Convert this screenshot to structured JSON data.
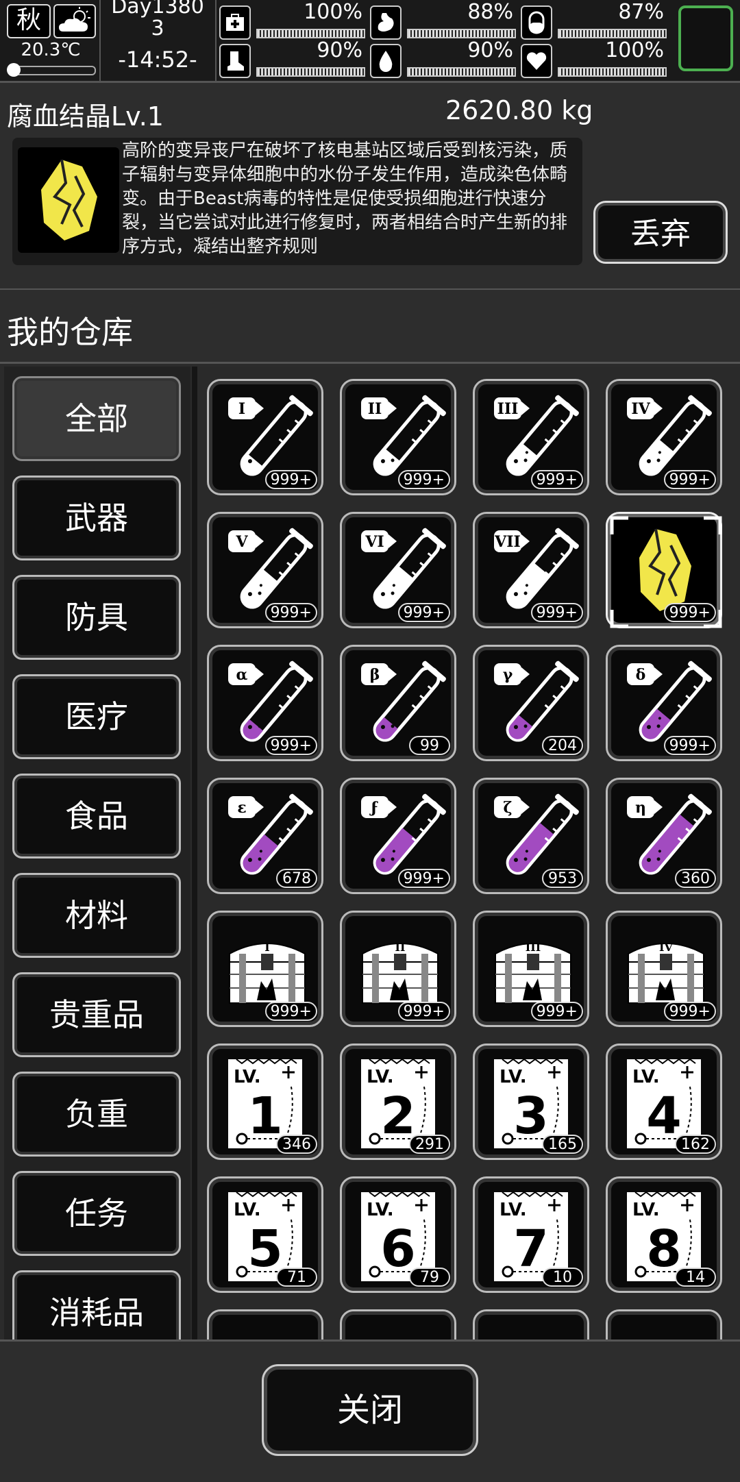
{
  "status": {
    "season": "秋",
    "weather_icon": "partly-cloudy-icon",
    "temperature": "20.3℃",
    "day_line1": "Day1380",
    "day_line2": "3",
    "time": "-14:52-",
    "stats": [
      {
        "name": "health",
        "icon": "medkit-icon",
        "value": "100%"
      },
      {
        "name": "hunger",
        "icon": "stomach-icon",
        "value": "88%"
      },
      {
        "name": "medicine",
        "icon": "pill-icon",
        "value": "87%"
      },
      {
        "name": "stamina",
        "icon": "boot-icon",
        "value": "90%"
      },
      {
        "name": "thirst",
        "icon": "water-drop-icon",
        "value": "90%"
      },
      {
        "name": "mood",
        "icon": "heart-icon",
        "value": "100%"
      }
    ]
  },
  "item": {
    "name": "腐血结晶Lv.1",
    "weight": "2620.80 kg",
    "description": "高阶的变异丧尸在破坏了核电基站区域后受到核污染，质子辐射与变异体细胞中的水份子发生作用，造成染色体畸变。由于Beast病毒的特性是促使受损细胞进行快速分裂，当它尝试对此进行修复时，两者相结合时产生新的排序方式，凝结出整齐规则",
    "discard_label": "丢弃"
  },
  "warehouse": {
    "title": "我的仓库",
    "categories": [
      "全部",
      "武器",
      "防具",
      "医疗",
      "食品",
      "材料",
      "贵重品",
      "负重",
      "任务",
      "消耗品"
    ],
    "items": [
      {
        "type": "tube",
        "label": "I",
        "count": "999+",
        "liquid": "#ffffff"
      },
      {
        "type": "tube",
        "label": "II",
        "count": "999+",
        "liquid": "#ffffff"
      },
      {
        "type": "tube",
        "label": "III",
        "count": "999+",
        "liquid": "#ffffff"
      },
      {
        "type": "tube",
        "label": "IV",
        "count": "999+",
        "liquid": "#ffffff"
      },
      {
        "type": "tube",
        "label": "V",
        "count": "999+",
        "liquid": "#ffffff"
      },
      {
        "type": "tube",
        "label": "VI",
        "count": "999+",
        "liquid": "#ffffff"
      },
      {
        "type": "tube",
        "label": "VII",
        "count": "999+",
        "liquid": "#ffffff"
      },
      {
        "type": "crystal",
        "label": "",
        "count": "999+",
        "selected": true
      },
      {
        "type": "tube",
        "label": "α",
        "count": "999+",
        "liquid": "#a24bc0"
      },
      {
        "type": "tube",
        "label": "β",
        "count": "99",
        "liquid": "#a24bc0"
      },
      {
        "type": "tube",
        "label": "γ",
        "count": "204",
        "liquid": "#a24bc0"
      },
      {
        "type": "tube",
        "label": "δ",
        "count": "999+",
        "liquid": "#a24bc0"
      },
      {
        "type": "tube",
        "label": "ε",
        "count": "678",
        "liquid": "#a24bc0"
      },
      {
        "type": "tube",
        "label": "ϝ",
        "count": "999+",
        "liquid": "#a24bc0"
      },
      {
        "type": "tube",
        "label": "ζ",
        "count": "953",
        "liquid": "#a24bc0"
      },
      {
        "type": "tube",
        "label": "η",
        "count": "360",
        "liquid": "#a24bc0"
      },
      {
        "type": "chest",
        "label": "I",
        "count": "999+"
      },
      {
        "type": "chest",
        "label": "II",
        "count": "999+"
      },
      {
        "type": "chest",
        "label": "III",
        "count": "999+"
      },
      {
        "type": "chest",
        "label": "IV",
        "count": "999+"
      },
      {
        "type": "ticket",
        "label": "1",
        "count": "346"
      },
      {
        "type": "ticket",
        "label": "2",
        "count": "291"
      },
      {
        "type": "ticket",
        "label": "3",
        "count": "165"
      },
      {
        "type": "ticket",
        "label": "4",
        "count": "162"
      },
      {
        "type": "ticket",
        "label": "5",
        "count": "71"
      },
      {
        "type": "ticket",
        "label": "6",
        "count": "79"
      },
      {
        "type": "ticket",
        "label": "7",
        "count": "10"
      },
      {
        "type": "ticket",
        "label": "8",
        "count": "14"
      },
      {
        "type": "partial",
        "label": "",
        "count": ""
      },
      {
        "type": "partial",
        "label": "",
        "count": ""
      },
      {
        "type": "partial",
        "label": "",
        "count": ""
      },
      {
        "type": "partial",
        "label": "",
        "count": ""
      }
    ],
    "ticket_prefix": "LV."
  },
  "footer": {
    "close_label": "关闭"
  }
}
